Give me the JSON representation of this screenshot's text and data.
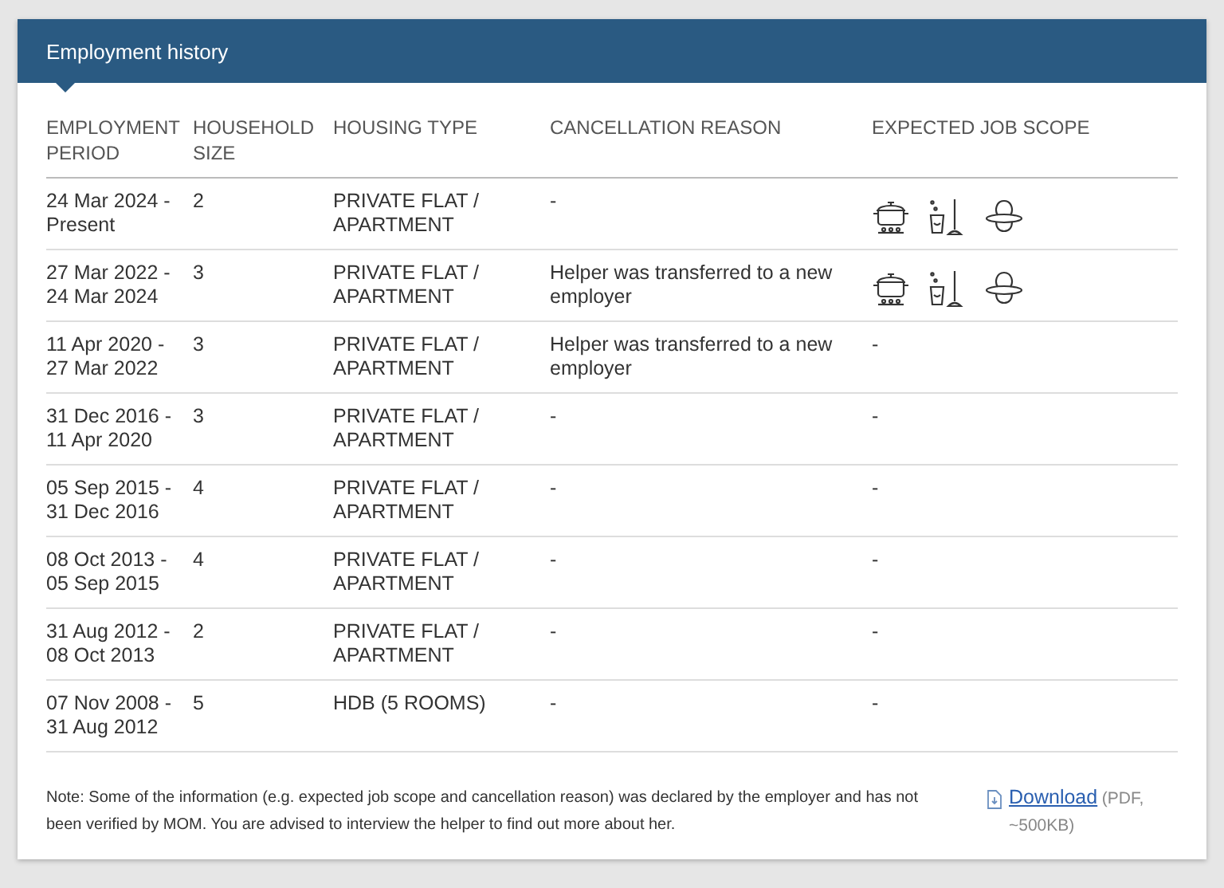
{
  "panel": {
    "title": "Employment history"
  },
  "table": {
    "columns": [
      "EMPLOYMENT PERIOD",
      "HOUSEHOLD SIZE",
      "HOUSING TYPE",
      "CANCELLATION REASON",
      "EXPECTED JOB SCOPE"
    ],
    "rows": [
      {
        "period": "24 Mar 2024 - Present",
        "household_size": "2",
        "housing_type": "PRIVATE FLAT / APARTMENT",
        "cancellation_reason": "-",
        "job_scope": [
          {
            "kind": "cooking"
          },
          {
            "kind": "cleaning"
          },
          {
            "kind": "infant_care"
          }
        ]
      },
      {
        "period": "27 Mar 2022 - 24 Mar 2024",
        "household_size": "3",
        "housing_type": "PRIVATE FLAT / APARTMENT",
        "cancellation_reason": "Helper was transferred to a new employer",
        "job_scope": [
          {
            "kind": "cooking"
          },
          {
            "kind": "cleaning"
          },
          {
            "kind": "infant_care"
          }
        ]
      },
      {
        "period": "11 Apr 2020 - 27 Mar 2022",
        "household_size": "3",
        "housing_type": "PRIVATE FLAT / APARTMENT",
        "cancellation_reason": "Helper was transferred to a new employer",
        "job_scope": "-"
      },
      {
        "period": "31 Dec 2016 - 11 Apr 2020",
        "household_size": "3",
        "housing_type": "PRIVATE FLAT / APARTMENT",
        "cancellation_reason": "-",
        "job_scope": "-"
      },
      {
        "period": "05 Sep 2015 - 31 Dec 2016",
        "household_size": "4",
        "housing_type": "PRIVATE FLAT / APARTMENT",
        "cancellation_reason": "-",
        "job_scope": "-"
      },
      {
        "period": "08 Oct 2013 - 05 Sep 2015",
        "household_size": "4",
        "housing_type": "PRIVATE FLAT / APARTMENT",
        "cancellation_reason": "-",
        "job_scope": "-"
      },
      {
        "period": "31 Aug 2012 - 08 Oct 2013",
        "household_size": "2",
        "housing_type": "PRIVATE FLAT / APARTMENT",
        "cancellation_reason": "-",
        "job_scope": "-"
      },
      {
        "period": "07 Nov 2008 - 31 Aug 2012",
        "household_size": "5",
        "housing_type": "HDB (5 ROOMS)",
        "cancellation_reason": "-",
        "job_scope": "-"
      }
    ]
  },
  "note": "Note: Some of the information (e.g. expected job scope and cancellation reason) was declared by the employer and has not been verified by MOM. You are advised to interview the helper to find out more about her.",
  "download": {
    "label": "Download",
    "info": "(PDF, ~500KB)"
  }
}
